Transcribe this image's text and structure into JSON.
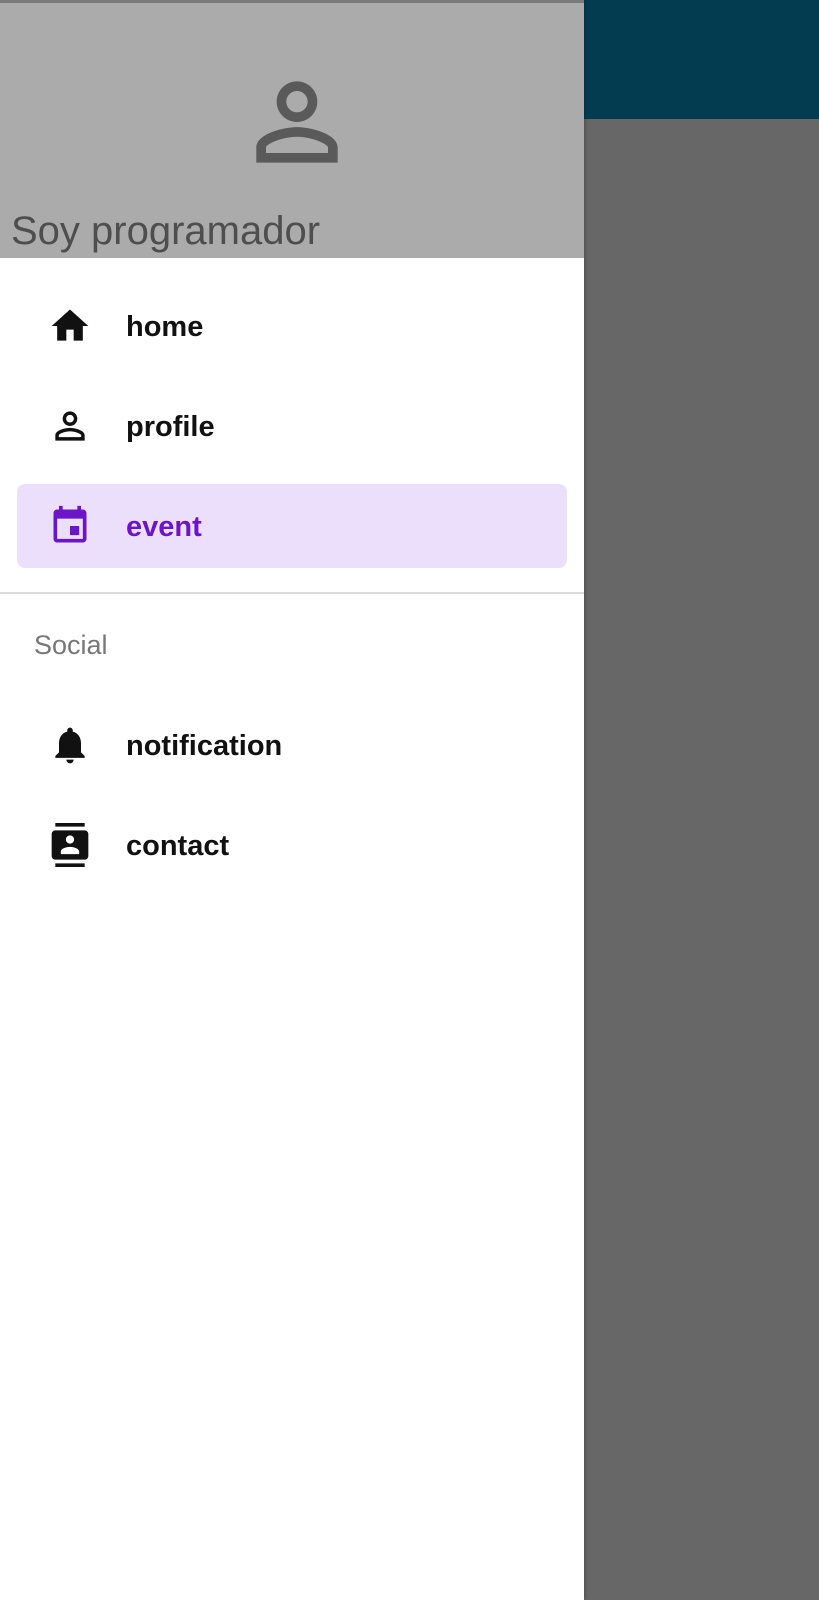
{
  "drawer": {
    "header": {
      "title": "Soy programador",
      "avatar_icon": "person-outline-icon"
    },
    "items": [
      {
        "id": "home",
        "label": "home",
        "icon": "home-icon",
        "selected": false
      },
      {
        "id": "profile",
        "label": "profile",
        "icon": "person-outline-icon",
        "selected": false
      },
      {
        "id": "event",
        "label": "event",
        "icon": "calendar-event-icon",
        "selected": true
      }
    ],
    "section": {
      "title": "Social",
      "items": [
        {
          "id": "notification",
          "label": "notification",
          "icon": "bell-icon",
          "selected": false
        },
        {
          "id": "contact",
          "label": "contact",
          "icon": "contact-book-icon",
          "selected": false
        }
      ]
    }
  },
  "colors": {
    "app_bar": "#033c51",
    "scrim": "#676767",
    "header_bg": "#ababab",
    "accent": "#6a15c8",
    "selected_bg": "#ecdffb"
  }
}
